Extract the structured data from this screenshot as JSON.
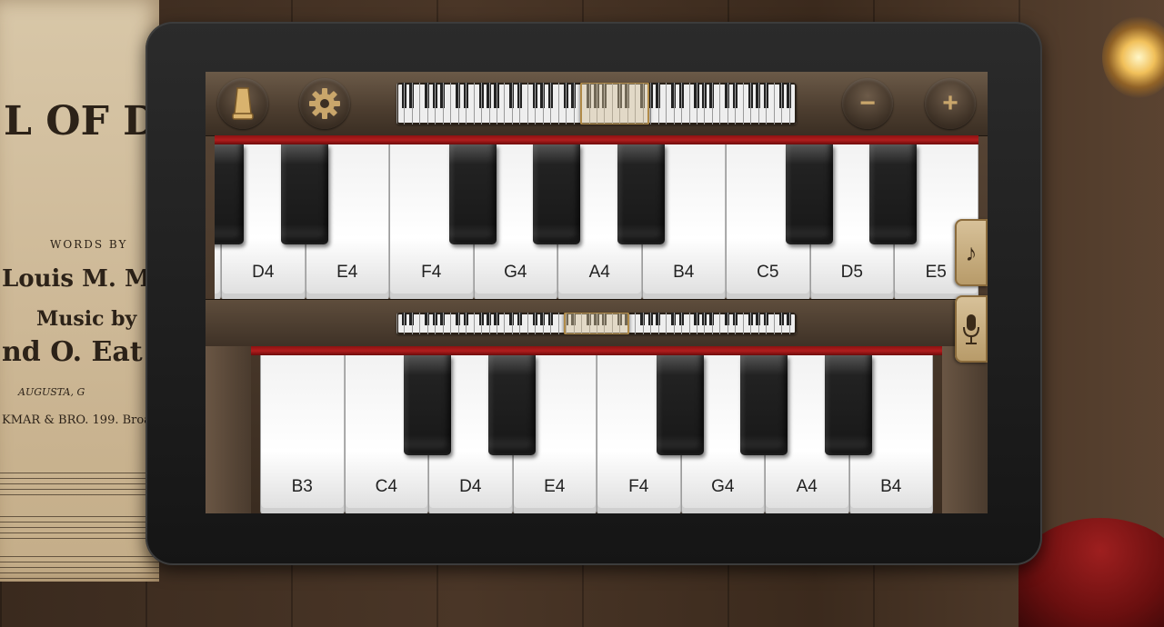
{
  "background": {
    "sheet_music": {
      "lines": [
        "WORDS BY",
        "Louis M. Montg",
        "Music by",
        "nd O. Eat",
        "AUGUSTA, G",
        "KMAR & BRO.  199. Broa"
      ],
      "title_fragment": "L OF D"
    }
  },
  "toolbar": {
    "metronome_icon": "metronome-icon",
    "settings_icon": "gear-icon",
    "zoom_out_label": "−",
    "zoom_in_label": "+"
  },
  "upper_keyboard": {
    "white_keys": [
      "D4",
      "E4",
      "F4",
      "G4",
      "A4",
      "B4",
      "C5",
      "D5",
      "E5"
    ]
  },
  "lower_keyboard": {
    "white_keys": [
      "B3",
      "C4",
      "D4",
      "E4",
      "F4",
      "G4",
      "A4",
      "B4"
    ]
  },
  "side_buttons": {
    "record_icon": "microphone-icon",
    "sheet_icon": "music-note-icon"
  },
  "colors": {
    "felt_red": "#a51818",
    "accent_gold": "#c9a66b"
  }
}
